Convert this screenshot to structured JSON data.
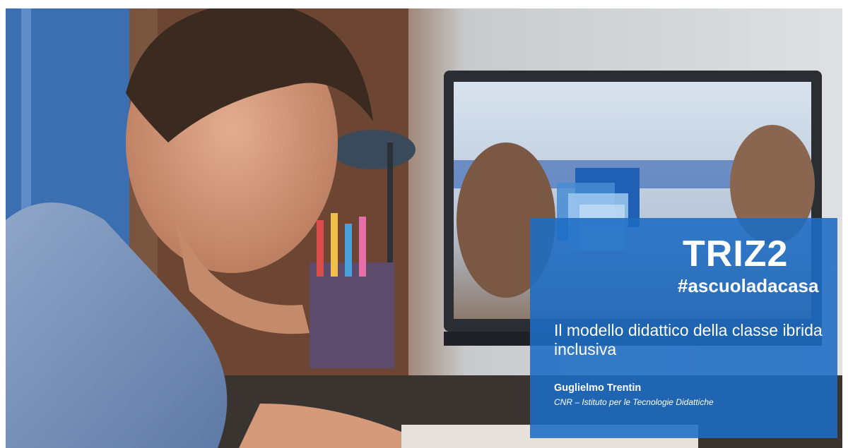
{
  "slide": {
    "logo_text": "TRIZ2",
    "hashtag": "#ascuoladacasa",
    "title": "Il modello didattico della classe ibrida inclusiva",
    "author": "Guglielmo Trentin",
    "institution": "CNR – Istituto per le Tecnologie Didattiche"
  },
  "colors": {
    "panel_blue": "#1c6cc4",
    "text": "#ffffff"
  }
}
